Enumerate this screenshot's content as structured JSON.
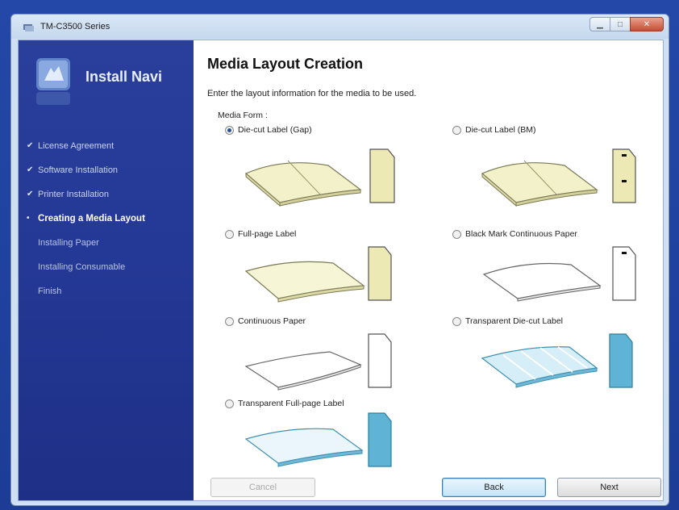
{
  "window": {
    "title": "TM-C3500 Series"
  },
  "sidebar": {
    "brand": "Install Navi",
    "steps": [
      {
        "label": "License Agreement",
        "state": "done"
      },
      {
        "label": "Software Installation",
        "state": "done"
      },
      {
        "label": "Printer Installation",
        "state": "done"
      },
      {
        "label": "Creating a Media Layout",
        "state": "current"
      },
      {
        "label": "Installing Paper",
        "state": "todo"
      },
      {
        "label": "Installing Consumable",
        "state": "todo"
      },
      {
        "label": "Finish",
        "state": "todo"
      }
    ],
    "done_mark": "✔",
    "current_mark": "•"
  },
  "main": {
    "heading": "Media Layout Creation",
    "instruction": "Enter the layout information for the media to be used.",
    "form_label": "Media Form :",
    "options": [
      {
        "label": "Die-cut Label (Gap)",
        "selected": true
      },
      {
        "label": "Die-cut Label (BM)",
        "selected": false
      },
      {
        "label": "Full-page Label",
        "selected": false
      },
      {
        "label": "Black Mark Continuous Paper",
        "selected": false
      },
      {
        "label": "Continuous Paper",
        "selected": false
      },
      {
        "label": "Transparent Die-cut Label",
        "selected": false
      },
      {
        "label": "Transparent Full-page Label",
        "selected": false
      }
    ]
  },
  "buttons": {
    "cancel": "Cancel",
    "back": "Back",
    "next": "Next"
  },
  "colors": {
    "sidebar": "#243996",
    "label_paper": "#ede9b4",
    "transparent": "#5fb3d4",
    "desktop": "#1e3a8a"
  }
}
